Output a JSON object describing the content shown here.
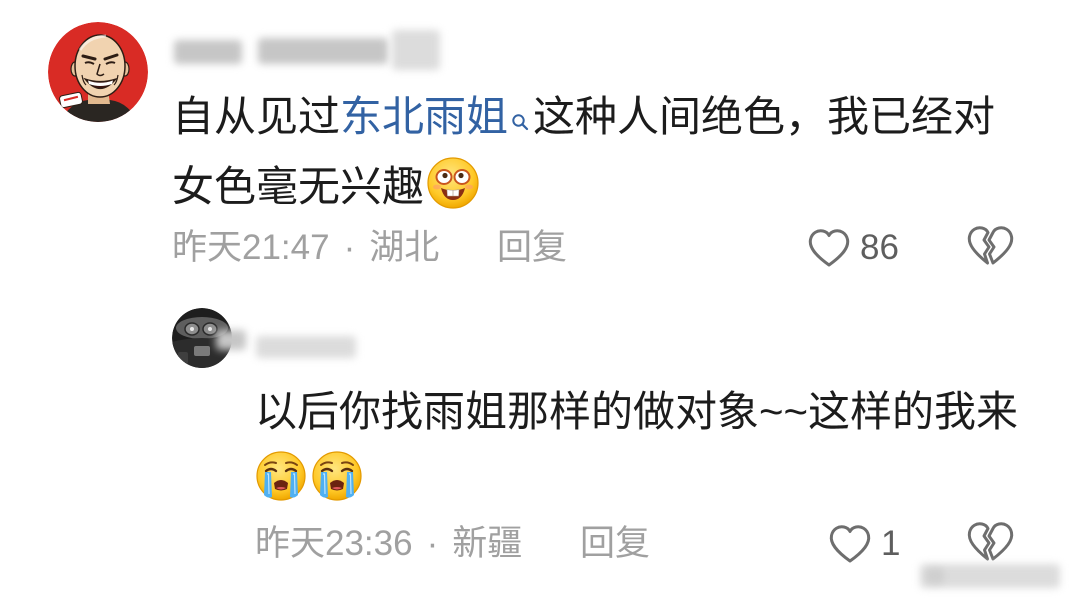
{
  "colors": {
    "background": "#ffffff",
    "text": "#1c1c1c",
    "link": "#3262a3",
    "meta": "#a0a0a0",
    "icon": "#6e6e6e",
    "count": "#5e5e5e"
  },
  "icons": {
    "search": "search-icon",
    "like": "heart-icon",
    "dislike": "broken-heart-icon"
  },
  "comment": {
    "text": {
      "prefix": "自从见过",
      "link": "东北雨姐",
      "line1_rest": "这种人间绝色，我已经对",
      "line2": "女色毫无兴趣",
      "emojis": [
        "grinning-teeth-emoji"
      ]
    },
    "meta": {
      "time": "昨天21:47",
      "separator": "·",
      "location": "湖北",
      "reply_label": "回复"
    },
    "like_count": "86"
  },
  "reply": {
    "text": {
      "line1": "以后你找雨姐那样的做对象~~这样的我来",
      "emojis": [
        "loudly-crying-emoji",
        "loudly-crying-emoji"
      ]
    },
    "meta": {
      "time": "昨天23:36",
      "separator": "·",
      "location": "新疆",
      "reply_label": "回复"
    },
    "like_count": "1"
  }
}
